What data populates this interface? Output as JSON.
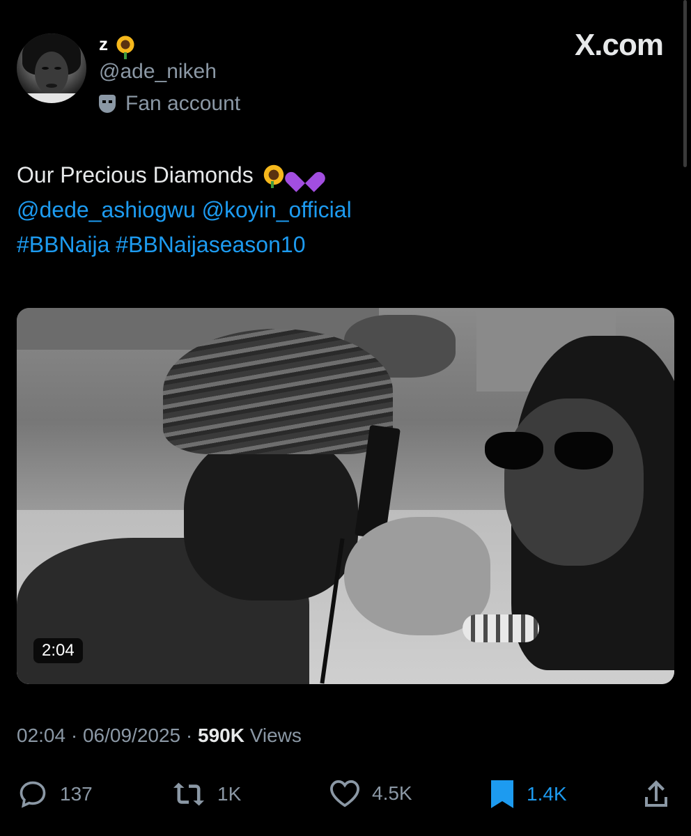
{
  "brand": "X.com",
  "author": {
    "display_name": "z",
    "handle": "@ade_nikeh",
    "label": "Fan account"
  },
  "tweet": {
    "text": "Our Precious Diamonds",
    "mentions": "@dede_ashiogwu @koyin_official",
    "hashtags": "#BBNaija #BBNaijaseason10"
  },
  "media": {
    "duration": "2:04"
  },
  "meta": {
    "time": "02:04",
    "date": "06/09/2025",
    "views_count": "590K",
    "views_label": "Views",
    "separator": "·"
  },
  "actions": {
    "replies": "137",
    "reposts": "1K",
    "likes": "4.5K",
    "bookmarks": "1.4K"
  },
  "colors": {
    "background": "#000000",
    "link": "#1d9bf0",
    "muted": "#8b98a5",
    "bookmark_active": "#1d9bf0"
  },
  "icons": [
    "sunflower-icon",
    "purple-heart-icon",
    "mask-icon",
    "reply-icon",
    "repost-icon",
    "like-icon",
    "bookmark-icon",
    "share-icon"
  ]
}
